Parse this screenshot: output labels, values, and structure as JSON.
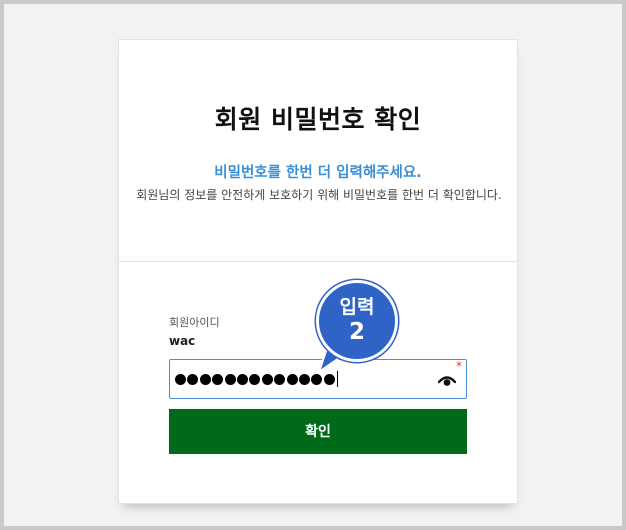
{
  "page": {
    "title": "회원 비밀번호 확인",
    "subtitle": "비밀번호를 한번 더 입력해주세요.",
    "description": "회원님의 정보를 안전하게 보호하기 위해 비밀번호를 한번 더 확인합니다."
  },
  "form": {
    "id_label": "회원아이디",
    "id_value": "wac",
    "password_dot_count": 13,
    "required_mark": "*",
    "eye_icon": "eye-icon",
    "confirm_label": "확인"
  },
  "annotation": {
    "badge_top": "입력",
    "badge_bottom": "2"
  },
  "colors": {
    "background": "#c9c9c9",
    "subtitle": "#3a8fd6",
    "button": "#006a1b",
    "field_border": "#4a90d9",
    "badge": "#2f63c5",
    "required": "#e53935"
  }
}
